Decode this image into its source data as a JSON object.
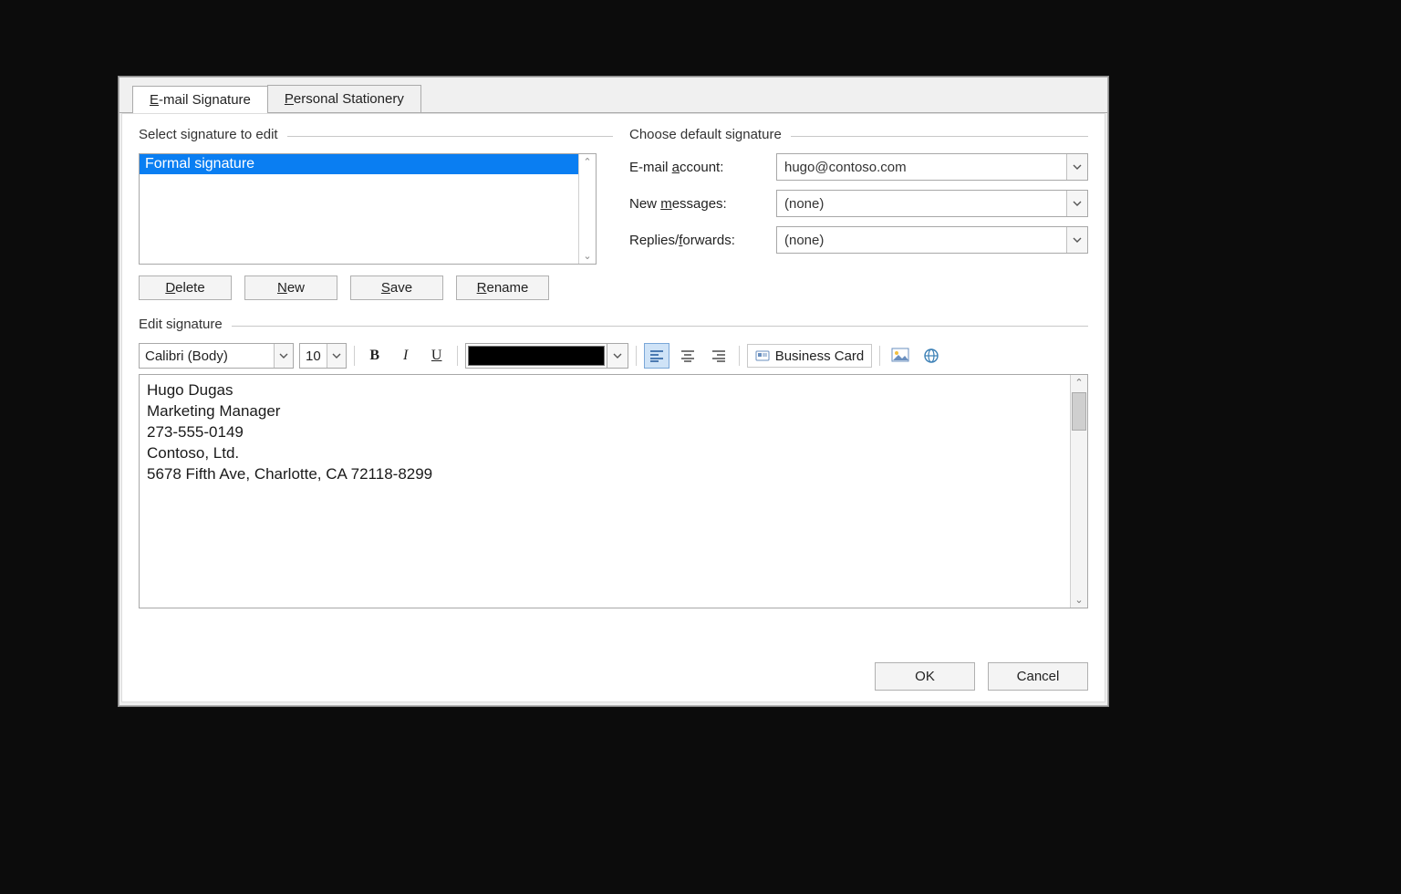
{
  "tabs": {
    "email_signature": "E-mail Signature",
    "personal_stationery": "Personal Stationery"
  },
  "select_group": {
    "label": "Select signature to edit",
    "items": [
      "Formal signature"
    ],
    "selected_index": 0,
    "buttons": {
      "delete": "Delete",
      "new": "New",
      "save": "Save",
      "rename": "Rename"
    }
  },
  "defaults_group": {
    "label": "Choose default signature",
    "email_account_label": "E-mail account:",
    "email_account_value": "hugo@contoso.com",
    "new_messages_label": "New messages:",
    "new_messages_value": "(none)",
    "replies_label": "Replies/forwards:",
    "replies_value": "(none)"
  },
  "edit_group": {
    "label": "Edit signature",
    "font_name": "Calibri (Body)",
    "font_size": "10",
    "color_hex": "#000000",
    "business_card_label": "Business Card",
    "content_lines": [
      "Hugo Dugas",
      "Marketing Manager",
      "273-555-0149",
      "Contoso, Ltd.",
      "5678 Fifth Ave, Charlotte, CA 72118-8299"
    ]
  },
  "dialog_buttons": {
    "ok": "OK",
    "cancel": "Cancel"
  }
}
